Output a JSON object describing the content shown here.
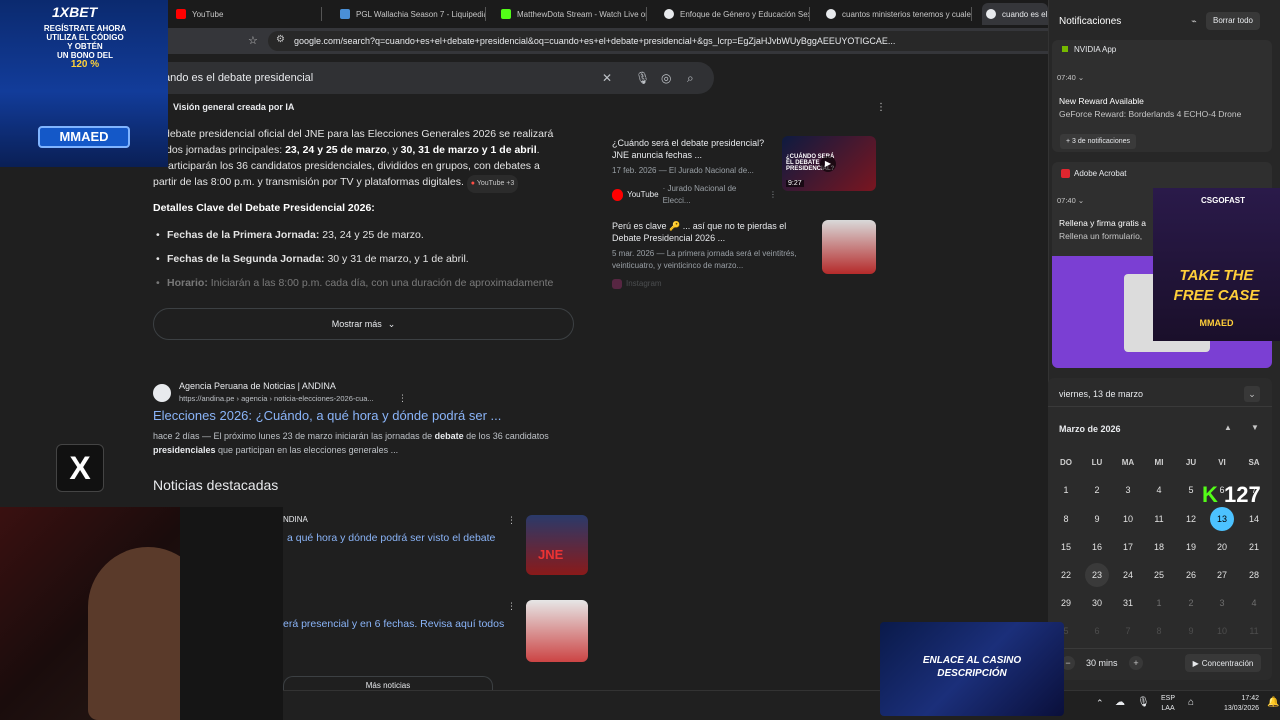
{
  "browser": {
    "tabs": [
      {
        "label": "YouTube",
        "color": "#ff0000"
      },
      {
        "label": "PGL Wallachia Season 7 - Liquipedia",
        "color": "#4a8fd6"
      },
      {
        "label": "MatthewDota Stream - Watch Live on",
        "color": "#53fc18"
      },
      {
        "label": "Enfoque de Género y Educación Sex",
        "color": "#e8eaed"
      },
      {
        "label": "cuantos ministerios tenemos y cuale",
        "color": "#e8eaed"
      },
      {
        "label": "cuando es el",
        "color": "#e8eaed"
      }
    ],
    "url": "google.com/search?q=cuando+es+el+debate+presidencial&oq=cuando+es+el+debate+presidencial+&gs_lcrp=EgZjaHJvbWUyBggAEEUYOTIGCAE..."
  },
  "search": {
    "query": "ando es el debate presidencial"
  },
  "ai_overview": {
    "title": "Visión general creada por IA",
    "intro_1": "debate presidencial oficial del JNE para las Elecciones Generales 2026 se realizará",
    "intro_2a": "dos jornadas principales: ",
    "intro_2b": "23, 24 y 25 de marzo",
    "intro_2c": ", y ",
    "intro_2d": "30, 31 de marzo y 1 de abril",
    "intro_2e": ".",
    "intro_3": "articiparán los 36 candidatos presidenciales, divididos en grupos, con debates a",
    "intro_4": "partir de las 8:00 p.m. y transmisión por TV y plataformas digitales.",
    "chip": "YouTube +3",
    "details_title": "Detalles Clave del Debate Presidencial 2026:",
    "bullets": [
      {
        "label": "Fechas de la Primera Jornada:",
        "text": " 23, 24 y 25 de marzo."
      },
      {
        "label": "Fechas de la Segunda Jornada:",
        "text": " 30 y 31 de marzo, y 1 de abril."
      },
      {
        "label": "Horario:",
        "text": " Iniciarán a las 8:00 p.m. cada día, con una duración de aproximadamente"
      }
    ],
    "show_more": "Mostrar más"
  },
  "side_cards": [
    {
      "title": "¿Cuándo será el debate presidencial? JNE anuncia fechas ...",
      "desc": "17 feb. 2026 — El Jurado Nacional de...",
      "source": "YouTube",
      "source_detail": "· Jurado Nacional de Elecci...",
      "thumb_text": "¿CUÁNDO SERÁ EL DEBATE PRESIDENCIAL?",
      "thumb_time": "9:27"
    },
    {
      "title": "Perú es clave 🔑 ... así que no te pierdas el Debate Presidencial 2026 ...",
      "desc": "5 mar. 2026 — La primera jornada será el veintitrés, veinticuatro, y veinticinco de marzo...",
      "source": "Instagram"
    }
  ],
  "result": {
    "site": "Agencia Peruana de Noticias | ANDINA",
    "url": "https://andina.pe › agencia › noticia-elecciones-2026-cua...",
    "title": "Elecciones 2026: ¿Cuándo, a qué hora y dónde podrá ser ...",
    "snippet_1a": "hace 2 días — El próximo lunes 23 de marzo iniciarán las jornadas de ",
    "snippet_1b": "debate",
    "snippet_1c": " de los 36 candidatos",
    "snippet_2a": "presidenciales",
    "snippet_2b": " que participan en las elecciones generales ..."
  },
  "news": {
    "heading": "Noticias destacadas",
    "items": [
      {
        "source": "NDINA",
        "title": "a qué hora y dónde podrá ser visto el debate",
        "thumb_text": "JNE"
      },
      {
        "source": "",
        "title": "erá presencial y en 6 fechas. Revisa aquí todos",
        "thumb_text": ""
      }
    ],
    "more": "Más noticias"
  },
  "notifications": {
    "title": "Notificaciones",
    "clear": "Borrar todo",
    "groups": [
      {
        "app": "NVIDIA App",
        "time": "07:40",
        "title": "New Reward Available",
        "body": "GeForce Reward: Borderlands 4 ECHO-4 Drone",
        "more": "+ 3 de notificaciones"
      },
      {
        "app": "Adobe Acrobat",
        "time": "07:40",
        "title": "Rellena y firma gratis a",
        "body": "Rellena un formulario,"
      }
    ]
  },
  "calendar": {
    "date_header": "viernes, 13 de marzo",
    "month": "Marzo de 2026",
    "dow": [
      "DO",
      "LU",
      "MA",
      "MI",
      "JU",
      "VI",
      "SA"
    ],
    "weeks": [
      [
        "1",
        "2",
        "3",
        "4",
        "5",
        "6",
        "7"
      ],
      [
        "8",
        "9",
        "10",
        "11",
        "12",
        "13",
        "14"
      ],
      [
        "15",
        "16",
        "17",
        "18",
        "19",
        "20",
        "21"
      ],
      [
        "22",
        "23",
        "24",
        "25",
        "26",
        "27",
        "28"
      ],
      [
        "29",
        "30",
        "31",
        "1",
        "2",
        "3",
        "4"
      ],
      [
        "5",
        "6",
        "7",
        "8",
        "9",
        "10",
        "11"
      ]
    ],
    "today": "13",
    "focus_time": "30 mins",
    "focus_label": "Concentración",
    "accent": "#4cc2ff"
  },
  "taskbar": {
    "lang_1": "ESP",
    "lang_2": "LAA",
    "time": "17:42",
    "date": "13/03/2026"
  },
  "overlays": {
    "bet_brand": "1XBET",
    "bet_line1": "REGÍSTRATE AHORA",
    "bet_line2": "UTILIZA EL CÓDIGO",
    "bet_line3": "Y OBTÉN",
    "bet_line4": "UN BONO DEL",
    "bet_percent": "120 %",
    "bet_code": "MMAED",
    "csgo_brand": "CSGOFAST",
    "csgo_line1": "TAKE THE",
    "csgo_line2": "FREE CASE",
    "csgo_code": "MMAED",
    "casino_line1": "ENLACE AL CASINO",
    "casino_line2": "DESCRIPCIÓN",
    "x_logo": "X",
    "kick_count": "127"
  }
}
